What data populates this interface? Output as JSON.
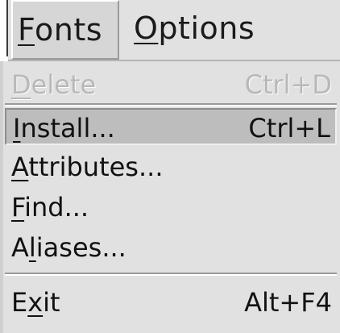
{
  "menubar": {
    "menus": [
      {
        "label": "Fonts",
        "mnemonic": "F",
        "rest": "onts",
        "active": true
      },
      {
        "label": "Options",
        "mnemonic": "O",
        "rest": "ptions",
        "active": false
      }
    ]
  },
  "dropdown": {
    "items": [
      {
        "label": "Delete",
        "mnemonic": "D",
        "rest": "elete",
        "accel": "Ctrl+D",
        "enabled": false,
        "highlighted": false
      },
      {
        "label": "Install...",
        "mnemonic": "I",
        "rest": "nstall...",
        "accel": "Ctrl+L",
        "enabled": true,
        "highlighted": true
      },
      {
        "label": "Attributes...",
        "mnemonic": "A",
        "rest": "ttributes...",
        "accel": "",
        "enabled": true,
        "highlighted": false
      },
      {
        "label": "Find...",
        "mnemonic": "F",
        "rest": "ind...",
        "accel": "",
        "enabled": true,
        "highlighted": false
      },
      {
        "label": "Aliases...",
        "pre": "A",
        "mnemonic": "l",
        "rest": "iases...",
        "accel": "",
        "enabled": true,
        "highlighted": false
      },
      {
        "label": "Exit",
        "pre": "E",
        "mnemonic": "x",
        "rest": "it",
        "accel": "Alt+F4",
        "enabled": true,
        "highlighted": false
      }
    ]
  }
}
